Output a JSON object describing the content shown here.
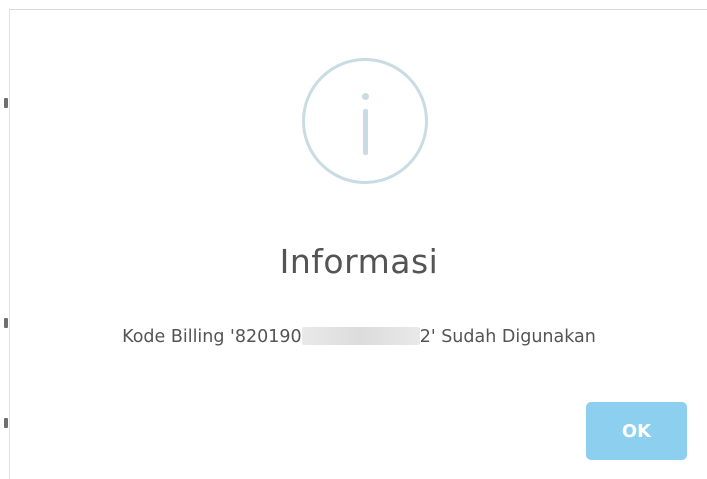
{
  "dialog": {
    "icon": "info-circle-icon",
    "title": "Informasi",
    "message": {
      "prefix": "Kode Billing '820190",
      "suffix": "2' Sudah Digunakan"
    },
    "ok_label": "OK"
  },
  "colors": {
    "icon": "#c9dbe3",
    "text": "#545454",
    "button": "#8ccfee",
    "button_text": "#ffffff"
  }
}
